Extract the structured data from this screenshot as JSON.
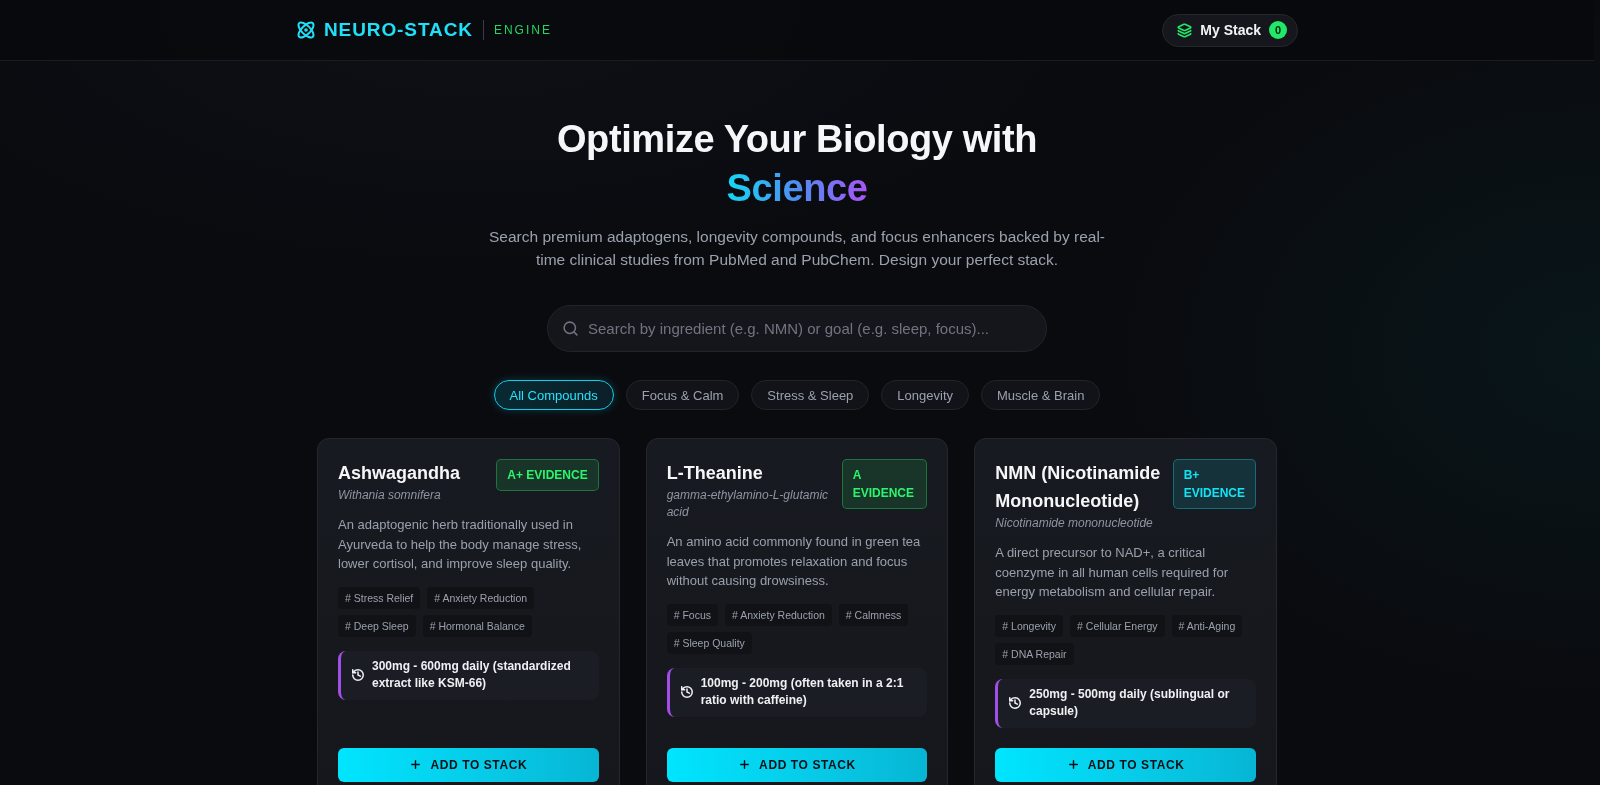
{
  "header": {
    "logo": "NEURO-STACK",
    "logo_tag": "ENGINE",
    "stack_button": {
      "label": "My Stack",
      "count": "0"
    }
  },
  "hero": {
    "title": "Optimize Your Biology with",
    "title_highlight": "Science",
    "subtitle": "Search premium adaptogens, longevity compounds, and focus enhancers backed by real-time clinical studies from PubMed and PubChem. Design your perfect stack."
  },
  "search": {
    "placeholder": "Search by ingredient (e.g. NMN) or goal (e.g. sleep, focus)..."
  },
  "filters": [
    {
      "label": "All Compounds",
      "selected": true
    },
    {
      "label": "Focus & Calm",
      "selected": false
    },
    {
      "label": "Stress & Sleep",
      "selected": false
    },
    {
      "label": "Longevity",
      "selected": false
    },
    {
      "label": "Muscle & Brain",
      "selected": false
    }
  ],
  "compounds": [
    {
      "name": "Ashwagandha",
      "latin_name": "Withania somnifera",
      "badge": {
        "label": "A+ EVIDENCE",
        "color": "#2bf56c"
      },
      "description": "An adaptogenic herb traditionally used in Ayurveda to help the body manage stress, lower cortisol, and improve sleep quality.",
      "tags": [
        "# Stress Relief",
        "# Anxiety Reduction",
        "# Deep Sleep",
        "# Hormonal Balance"
      ],
      "dosage": "300mg - 600mg daily (standardized extract like KSM-66)",
      "button": "ADD TO STACK"
    },
    {
      "name": "L-Theanine",
      "latin_name": "gamma-ethylamino-L-glutamic acid",
      "badge": {
        "label": "A EVIDENCE",
        "color": "#2bf56c"
      },
      "description": "An amino acid commonly found in green tea leaves that promotes relaxation and focus without causing drowsiness.",
      "tags": [
        "# Focus",
        "# Anxiety Reduction",
        "# Calmness",
        "# Sleep Quality"
      ],
      "dosage": "100mg - 200mg (often taken in a 2:1 ratio with caffeine)",
      "button": "ADD TO STACK"
    },
    {
      "name": "NMN (Nicotinamide Mononucleotide)",
      "latin_name": "Nicotinamide mononucleotide",
      "badge": {
        "label": "B+ EVIDENCE",
        "color": "#14e3f5"
      },
      "description": "A direct precursor to NAD+, a critical coenzyme in all human cells required for energy metabolism and cellular repair.",
      "tags": [
        "# Longevity",
        "# Cellular Energy",
        "# Anti-Aging",
        "# DNA Repair"
      ],
      "dosage": "250mg - 500mg daily (sublingual or capsule)",
      "button": "ADD TO STACK"
    }
  ]
}
